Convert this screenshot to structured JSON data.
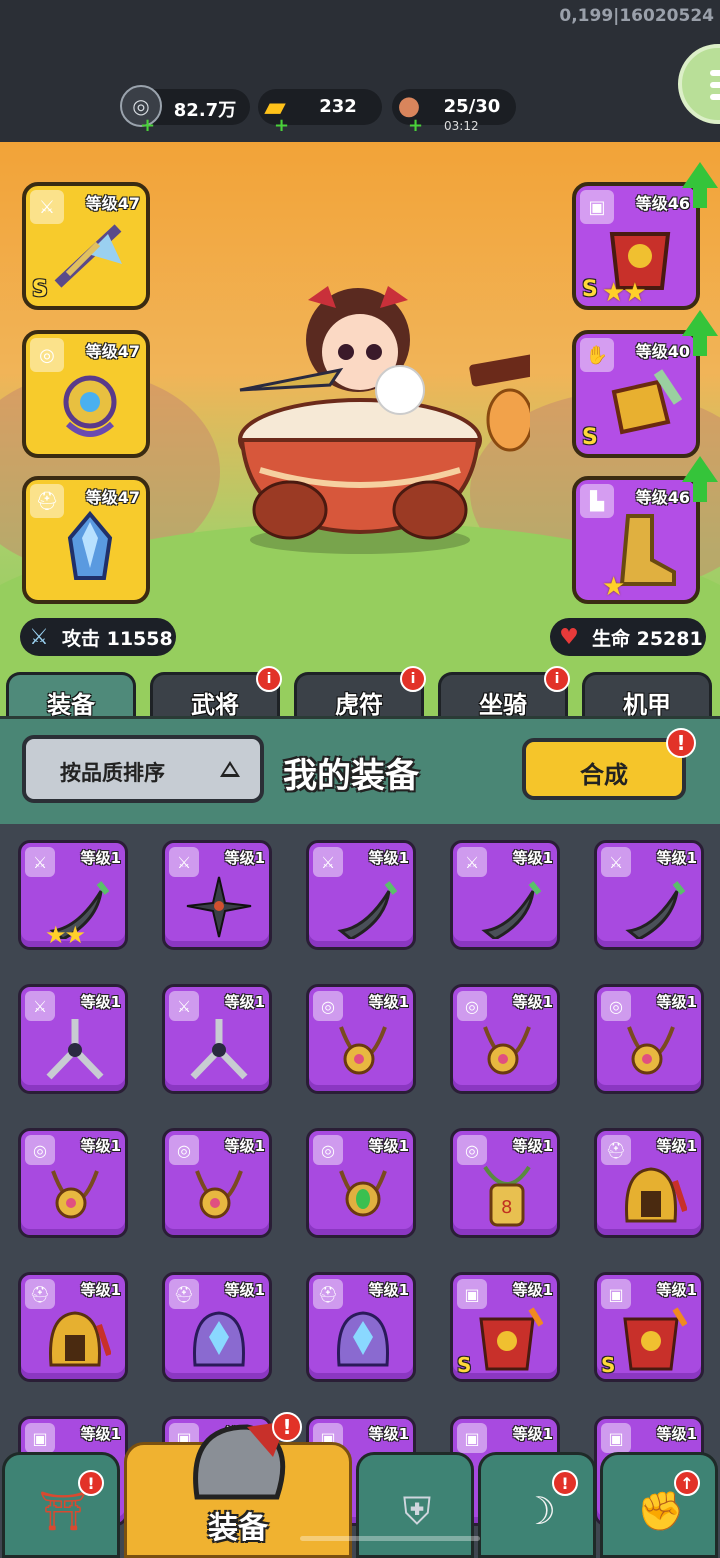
{
  "debug_text": "0,199|16020524",
  "currencies": [
    {
      "name": "silver",
      "icon": "silver-coin-icon",
      "value": "82.7万",
      "sub": ""
    },
    {
      "name": "gold",
      "icon": "gold-ingot-icon",
      "value": "232",
      "sub": ""
    },
    {
      "name": "stamina",
      "icon": "meat-icon",
      "value": "25/30",
      "sub": "03:12"
    }
  ],
  "left_slots": [
    {
      "level": "等级47",
      "type": "sword-icon",
      "rank": "S"
    },
    {
      "level": "等级47",
      "type": "medal-icon",
      "rank": ""
    },
    {
      "level": "等级47",
      "type": "helmet-icon",
      "rank": ""
    }
  ],
  "right_slots": [
    {
      "level": "等级46",
      "type": "armor-icon",
      "rank": "S",
      "stars": "★★"
    },
    {
      "level": "等级40",
      "type": "gauntlet-icon",
      "rank": "S",
      "stars": ""
    },
    {
      "level": "等级46",
      "type": "boot-icon",
      "rank": "",
      "stars": "★"
    }
  ],
  "stats": {
    "attack": "攻击 11558",
    "life": "生命 25281"
  },
  "tabs": [
    "装备",
    "武将",
    "虎符",
    "坐骑",
    "机甲"
  ],
  "toolbar": {
    "sort_label": "按品质排序",
    "title": "我的装备",
    "synth_label": "合成"
  },
  "items": [
    {
      "level": "等级1",
      "tag": "sword-icon",
      "art": "scimitar",
      "rank": "",
      "stars": "★★"
    },
    {
      "level": "等级1",
      "tag": "sword-icon",
      "art": "shuriken",
      "rank": "",
      "stars": ""
    },
    {
      "level": "等级1",
      "tag": "sword-icon",
      "art": "scimitar",
      "rank": "",
      "stars": ""
    },
    {
      "level": "等级1",
      "tag": "sword-icon",
      "art": "scimitar",
      "rank": "",
      "stars": ""
    },
    {
      "level": "等级1",
      "tag": "sword-icon",
      "art": "scimitar",
      "rank": "",
      "stars": ""
    },
    {
      "level": "等级1",
      "tag": "sword-icon",
      "art": "tri-blade",
      "rank": "",
      "stars": ""
    },
    {
      "level": "等级1",
      "tag": "sword-icon",
      "art": "tri-blade",
      "rank": "",
      "stars": ""
    },
    {
      "level": "等级1",
      "tag": "medal-icon",
      "art": "amulet",
      "rank": "",
      "stars": ""
    },
    {
      "level": "等级1",
      "tag": "medal-icon",
      "art": "amulet",
      "rank": "",
      "stars": ""
    },
    {
      "level": "等级1",
      "tag": "medal-icon",
      "art": "amulet",
      "rank": "",
      "stars": ""
    },
    {
      "level": "等级1",
      "tag": "medal-icon",
      "art": "amulet",
      "rank": "",
      "stars": ""
    },
    {
      "level": "等级1",
      "tag": "medal-icon",
      "art": "amulet",
      "rank": "",
      "stars": ""
    },
    {
      "level": "等级1",
      "tag": "medal-icon",
      "art": "jade-amulet",
      "rank": "",
      "stars": ""
    },
    {
      "level": "等级1",
      "tag": "medal-icon",
      "art": "talisman",
      "rank": "",
      "stars": ""
    },
    {
      "level": "等级1",
      "tag": "helmet-icon",
      "art": "gold-helmet",
      "rank": "",
      "stars": ""
    },
    {
      "level": "等级1",
      "tag": "helmet-icon",
      "art": "gold-helmet",
      "rank": "",
      "stars": ""
    },
    {
      "level": "等级1",
      "tag": "helmet-icon",
      "art": "crystal-helmet",
      "rank": "",
      "stars": ""
    },
    {
      "level": "等级1",
      "tag": "helmet-icon",
      "art": "crystal-helmet",
      "rank": "",
      "stars": ""
    },
    {
      "level": "等级1",
      "tag": "armor-icon",
      "art": "red-armor",
      "rank": "S",
      "stars": ""
    },
    {
      "level": "等级1",
      "tag": "armor-icon",
      "art": "red-armor",
      "rank": "S",
      "stars": ""
    },
    {
      "level": "等级1",
      "tag": "armor-icon",
      "art": "",
      "rank": "",
      "stars": ""
    },
    {
      "level": "等级1",
      "tag": "armor-icon",
      "art": "",
      "rank": "",
      "stars": ""
    },
    {
      "level": "等级1",
      "tag": "armor-icon",
      "art": "",
      "rank": "",
      "stars": ""
    },
    {
      "level": "等级1",
      "tag": "armor-icon",
      "art": "",
      "rank": "",
      "stars": ""
    },
    {
      "level": "等级1",
      "tag": "armor-icon",
      "art": "",
      "rank": "",
      "stars": ""
    }
  ],
  "nav": {
    "active_label": "装备",
    "buttons": [
      "shop-gate-icon",
      "equipment-helmet-icon",
      "battle-shield-icon",
      "mount-horn-icon",
      "fist-upgrade-icon"
    ]
  },
  "colors": {
    "accent": "#4a8675",
    "item_purple": "#a84ae0",
    "slot_gold": "#f7cb2c",
    "badge_red": "#e23228"
  }
}
